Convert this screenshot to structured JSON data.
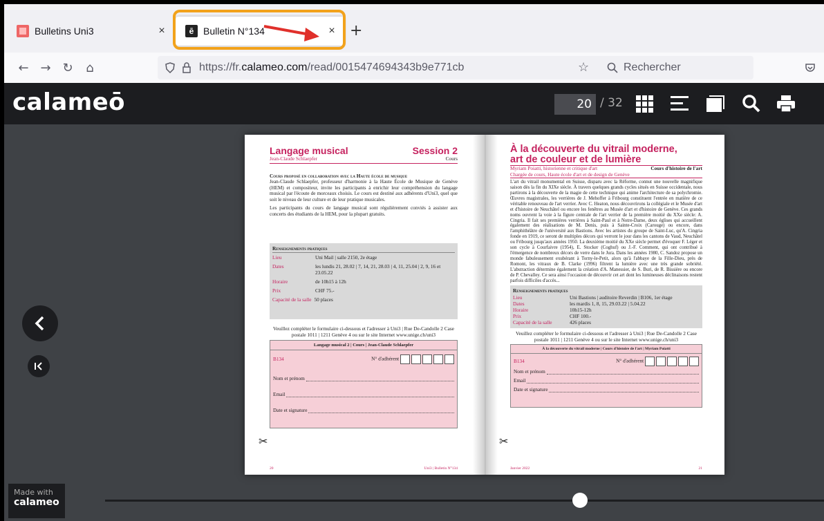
{
  "browser": {
    "tabs": [
      {
        "title": "Bulletins Uni3"
      },
      {
        "title": "Bulletin N°134"
      }
    ],
    "new_tab": "+",
    "close_glyph": "×",
    "url_prefix": "https://fr.",
    "url_domain": "calameo.com",
    "url_path": "/read/0015474694343b9e771cb",
    "search_placeholder": "Rechercher",
    "highlight_color": "#f2a21b",
    "arrow_color": "#e0302b"
  },
  "viewer": {
    "logo": "calameō",
    "page_current": "20",
    "page_total": "/ 32",
    "made_with": "Made with",
    "made_with_brand": "calameo"
  },
  "left_page": {
    "title": "Langage musical",
    "session": "Session 2",
    "author": "Jean-Claude Schlaepfer",
    "type": "Cours",
    "lead": "Cours proposé en collaboration avec la Haute école de musique",
    "para1": "Jean-Claude Schlaepfer, professeur d'harmonie à la Haute École de Musique de Genève (HEM) et compositeur, invite les participants à enrichir leur compréhension du langage musical par l'écoute de morceaux choisis. Le cours est destiné aux adhérents d'Uni3, quel que soit le niveau de leur culture et de leur pratique musicales.",
    "para2": "Les participants du cours de langage musical sont régulièrement conviés à assister aux concerts des étudiants de la HEM, pour la plupart gratuits.",
    "info_title": "Renseignements pratiques",
    "info": [
      {
        "k": "Lieu",
        "v": "Uni Mail | salle 2150, 2e étage"
      },
      {
        "k": "Dates",
        "v": "les lundis 21, 28.02 | 7, 14, 21, 28.03 | 4, 11, 25.04 | 2, 9, 16 et 23.05.22"
      },
      {
        "k": "Horaire",
        "v": "de 10h15 à 12h"
      },
      {
        "k": "Prix",
        "v": "CHF 75.-"
      },
      {
        "k": "Capacité de la salle",
        "v": "50 places"
      }
    ],
    "form_intro": "Veuillez compléter le formulaire ci-dessous et l'adresser à Uni3 | Rue De-Candolle 2 Case postale 1011 | 1211 Genève 4 ou sur le site Internet www.unige.ch/uni3",
    "form_header": "Langage musical 2 | Cours | Jean-Claude Schlaepfer",
    "form_code": "B134",
    "form_member": "N° d'adhérent",
    "form_name": "Nom et prénom",
    "form_email": "Email",
    "form_date": "Date et signature",
    "footer_num": "20",
    "footer_text": "Uni3 | Bulletin N°134"
  },
  "right_page": {
    "title1": "À la découverte du vitrail moderne,",
    "title2": "art de couleur et de lumière",
    "author": "Myriam Poiatti, historienne et critique d'art",
    "type": "Cours d'histoire de l'art",
    "author2": "Chargée de cours, Haute école d'art et de design de Genève",
    "para": "L'art du vitrail monumental en Suisse, disparu avec la Réforme, connut une nouvelle magnifique saison dès la fin du XIXe siècle. À travers quelques grands cycles situés en Suisse occidentale, nous partirons à la découverte de la magie de cette technique qui anime l'architecture de sa polychromie. Œuvres magistrales, les verrières de J. Mehoffer à Fribourg constituent l'entrée en matière de ce véritable renouveau de l'art verrier. Avec C. Heaton, nous découvrirons la collégiale et le Musée d'art et d'histoire de Neuchâtel ou encore les fenêtres au Musée d'art et d'histoire de Genève. Ces grands noms ouvrent la voie à la figure centrale de l'art verrier de la première moitié du XXe siècle: A. Cingria. Il fait ses premières verrières à Saint-Paul et à Notre-Dame, deux églises qui accueillent également des réalisations de M. Denis, puis à Sainte-Croix (Carouge) ou encore, dans l'amphithéâtre de l'université aux Bastions. Avec les artistes du groupe de Saint-Luc, qu'A. Cingria fonde en 1919, ce seront de multiples décors qui verront le jour dans les cantons de Vaud, Neuchâtel ou Fribourg jusqu'aux années 1950. La deuxième moitié du XXe siècle permet d'évoquer F. Léger et son cycle à Courfaivre (1954), E. Stocker (Coghuf) ou J.-F. Comment, qui ont contribué à l'émergence de nombreux décors de verre dans le Jura. Dans les années 1980, C. Sandoz propose un monde fabuleusement exubérant à Torny-le-Petit, alors qu'à l'abbaye de la Fille-Dieu, près de Romont, les vitraux de B. Clarke (1996) filtrent la lumière avec une très grande sobriété. L'abstraction détermine également la création d'A. Manessier, de S. Buri, de R. Bissière ou encore de P. Chevalley. Ce sera ainsi l'occasion de découvrir cet art dont les lumineuses déclinaisons restent parfois difficiles d'accès...",
    "info_title": "Renseignements pratiques",
    "info": [
      {
        "k": "Lieu",
        "v": "Uni Bastions | auditoire Reverdin | B106, 1er étage"
      },
      {
        "k": "Dates",
        "v": "les mardis 1, 8, 15, 29.03.22 | 5.04.22"
      },
      {
        "k": "Horaire",
        "v": "10h15-12h"
      },
      {
        "k": "Prix",
        "v": "CHF 100.-"
      },
      {
        "k": "Capacité de la salle",
        "v": "426 places"
      }
    ],
    "form_intro": "Veuillez compléter le formulaire ci-dessous et l'adresser à Uni3 | Rue De-Candolle 2 Case postale 1011 | 1211 Genève 4 ou sur le site Internet www.unige.ch/uni3",
    "form_header": "À la découverte du vitrail moderne | Cours d'histoire de l'art | Myriam Poiatti",
    "form_code": "B134",
    "form_member": "N° d'adhérent",
    "form_name": "Nom et prénom",
    "form_email": "Email",
    "form_date": "Date et signature",
    "footer_num": "21",
    "footer_text": "Janvier 2022"
  },
  "icons": [
    "back-icon",
    "forward-icon",
    "reload-icon",
    "home-icon",
    "shield-icon",
    "lock-icon",
    "bookmark-star-icon",
    "search-icon",
    "pocket-icon",
    "grid-icon",
    "list-icon",
    "folder-icon",
    "print-icon",
    "chevron-left-icon",
    "first-page-icon",
    "scissors-icon"
  ]
}
